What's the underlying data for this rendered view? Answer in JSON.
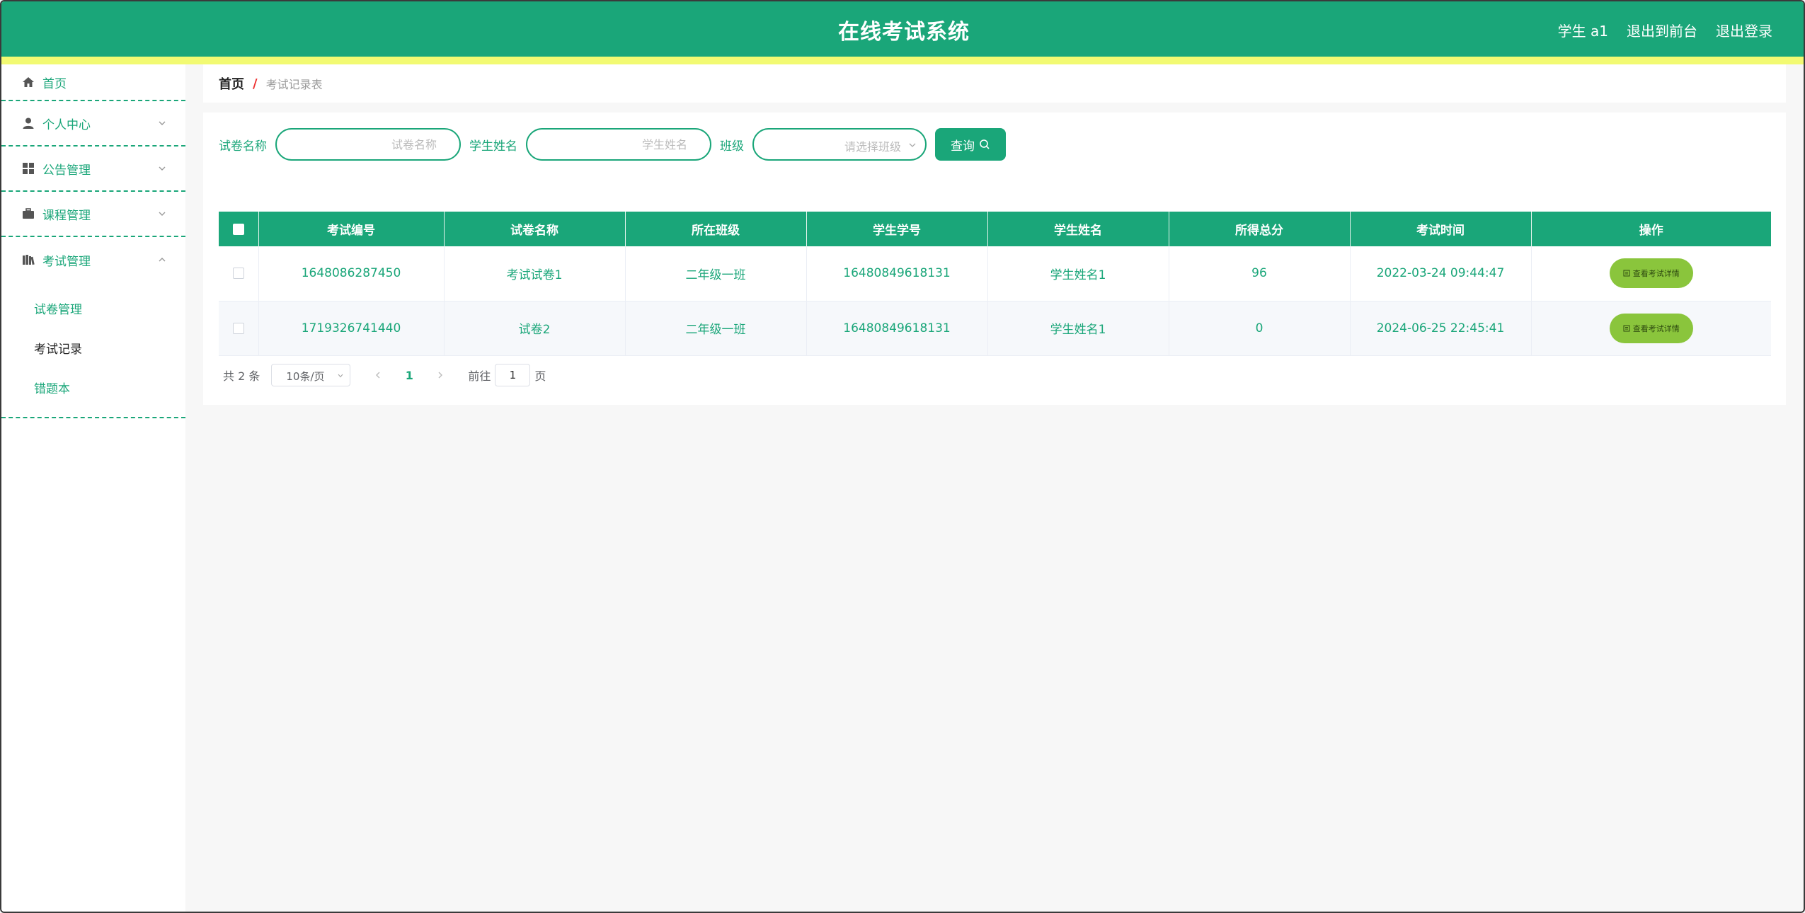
{
  "header": {
    "title": "在线考试系统",
    "user": "学生 a1",
    "to_front": "退出到前台",
    "logout": "退出登录"
  },
  "colors": {
    "primary": "#1aa679",
    "accent_strip": "#f2fa72",
    "detail_button": "#8ac53c"
  },
  "sidebar": {
    "home": {
      "label": "首页",
      "icon": "home-icon"
    },
    "groups": [
      {
        "label": "个人中心",
        "icon": "user-icon"
      },
      {
        "label": "公告管理",
        "icon": "grid-icon"
      },
      {
        "label": "课程管理",
        "icon": "briefcase-icon"
      },
      {
        "label": "考试管理",
        "icon": "books-icon"
      }
    ],
    "exam_sub": [
      {
        "label": "试卷管理"
      },
      {
        "label": "考试记录"
      },
      {
        "label": "错题本"
      }
    ]
  },
  "breadcrumb": {
    "home": "首页",
    "separator": "/",
    "current": "考试记录表"
  },
  "filters": {
    "paper_label": "试卷名称",
    "paper_placeholder": "试卷名称",
    "student_label": "学生姓名",
    "student_placeholder": "学生姓名",
    "class_label": "班级",
    "class_placeholder": "请选择班级",
    "query_button": "查询"
  },
  "table": {
    "columns": [
      "考试编号",
      "试卷名称",
      "所在班级",
      "学生学号",
      "学生姓名",
      "所得总分",
      "考试时间",
      "操作"
    ],
    "rows": [
      {
        "exam_id": "1648086287450",
        "paper": "考试试卷1",
        "class": "二年级一班",
        "student_no": "16480849618131",
        "student_name": "学生姓名1",
        "score": "96",
        "time": "2022-03-24 09:44:47",
        "action": "查看考试详情"
      },
      {
        "exam_id": "1719326741440",
        "paper": "试卷2",
        "class": "二年级一班",
        "student_no": "16480849618131",
        "student_name": "学生姓名1",
        "score": "0",
        "time": "2024-06-25 22:45:41",
        "action": "查看考试详情"
      }
    ]
  },
  "pagination": {
    "total": "共 2 条",
    "page_size": "10条/页",
    "current_page": "1",
    "goto_label": "前往",
    "goto_value": "1",
    "page_suffix": "页"
  }
}
